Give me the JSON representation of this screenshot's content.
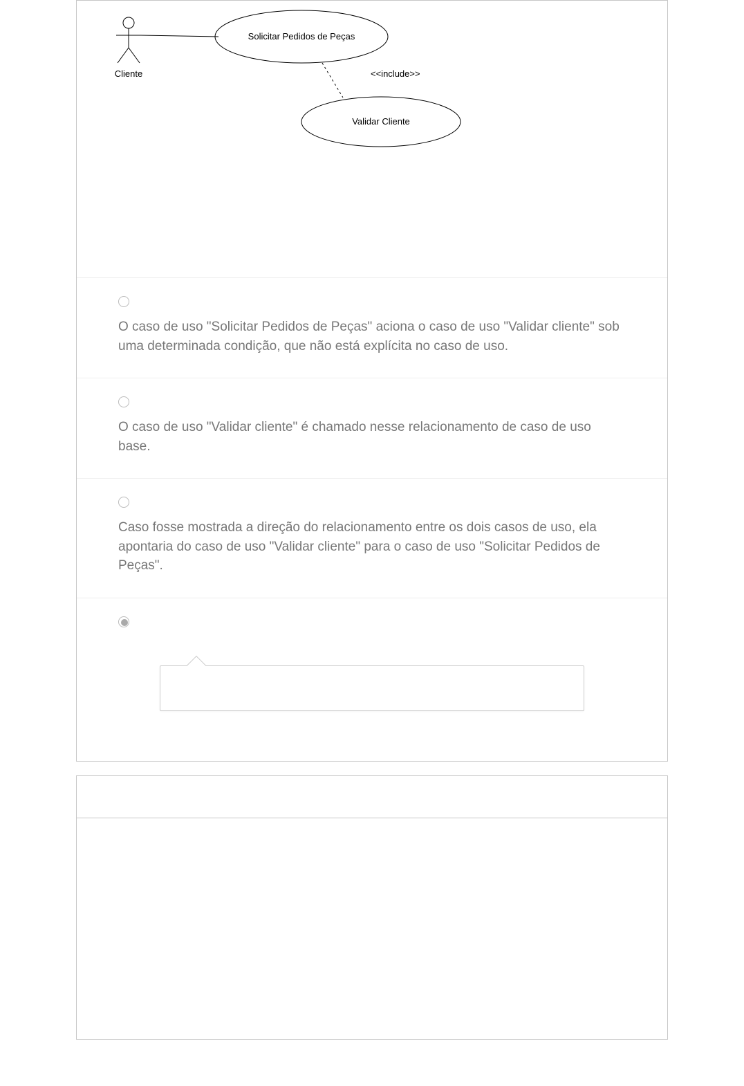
{
  "diagram": {
    "actor_label": "Cliente",
    "usecase1_label": "Solicitar Pedidos de Peças",
    "usecase2_label": "Validar Cliente",
    "relationship_label": "<<include>>"
  },
  "options": [
    {
      "text": "O caso de uso \"Solicitar Pedidos de Peças\" aciona o caso de uso \"Validar cliente\" sob uma determinada condição, que não está explícita no caso de uso.",
      "selected": false
    },
    {
      "text": "O caso de uso \"Validar cliente\" é chamado nesse relacionamento de caso de uso base.",
      "selected": false
    },
    {
      "text": "Caso fosse mostrada a direção do relacionamento entre os dois casos de uso, ela apontaria do caso de uso \"Validar cliente\" para o caso de uso \"Solicitar Pedidos de Peças\".",
      "selected": false
    },
    {
      "text": "",
      "selected": true
    }
  ],
  "feedback": ""
}
